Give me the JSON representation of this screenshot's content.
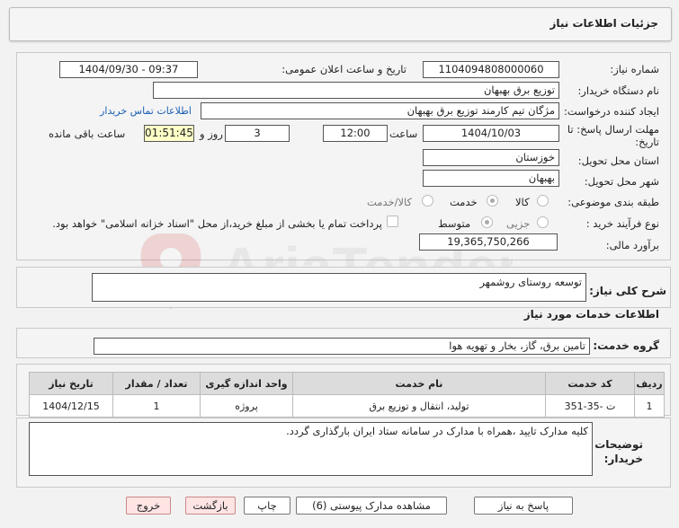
{
  "header": {
    "title": "جزئیات اطلاعات نیاز"
  },
  "form": {
    "need_number_label": "شماره نیاز:",
    "need_number": "1104094808000060",
    "announce_label": "تاریخ و ساعت اعلان عمومی:",
    "announce_value": "1404/09/30 - 09:37",
    "buyer_org_label": "نام دستگاه خریدار:",
    "buyer_org": "توزیع برق بهبهان",
    "creator_label": "ایجاد کننده درخواست:",
    "creator": "مژگان تیم کارمند توزیع برق بهبهان",
    "contact_link": "اطلاعات تماس خریدار",
    "deadline_label_1": "مهلت ارسال پاسخ: تا",
    "deadline_label_2": "تاریخ:",
    "deadline_date": "1404/10/03",
    "time_label": "ساعت",
    "deadline_time": "12:00",
    "days_value": "3",
    "days_label": "روز و",
    "remaining_time": "01:51:45",
    "remaining_label": "ساعت باقی مانده",
    "province_label": "استان محل تحویل:",
    "province": "خوزستان",
    "city_label": "شهر محل تحویل:",
    "city": "بهبهان",
    "category_label": "طبقه بندی موضوعی:",
    "category_options": [
      "کالا",
      "خدمت",
      "کالا/خدمت"
    ],
    "category_selected": "خدمت",
    "process_label": "نوع فرآیند خرید :",
    "process_options": [
      "جزیی",
      "متوسط"
    ],
    "process_selected": "متوسط",
    "payment_note": "پرداخت تمام یا بخشی از مبلغ خرید،از محل \"اسناد خزانه اسلامی\" خواهد بود.",
    "budget_label": "برآورد مالی:",
    "budget": "19,365,750,266"
  },
  "description": {
    "label": "شرح کلی نیاز:",
    "value": "توسعه روستای روشمهر"
  },
  "services": {
    "section_title": "اطلاعات خدمات مورد نیاز",
    "group_label": "گروه خدمت:",
    "group_value": "تامین برق، گاز، بخار و تهویه هوا",
    "columns": [
      "ردیف",
      "کد خدمت",
      "نام خدمت",
      "واحد اندازه گیری",
      "تعداد / مقدار",
      "تاریخ نیاز"
    ],
    "rows": [
      [
        "1",
        "ت -35-351",
        "تولید، انتقال و توزیع برق",
        "پروژه",
        "1",
        "1404/12/15"
      ]
    ]
  },
  "buyer_notes": {
    "label_1": "توضیحات",
    "label_2": "خریدار:",
    "value": "کلیه مدارک تایید ،همراه با مدارک در سامانه ستاد ایران بارگذاری گردد."
  },
  "buttons": {
    "reply": "پاسخ به نیاز",
    "view_docs": "مشاهده مدارک پیوستی (6)",
    "print": "چاپ",
    "back": "بازگشت",
    "exit": "خروج"
  },
  "watermark": "AriaTender.neT"
}
